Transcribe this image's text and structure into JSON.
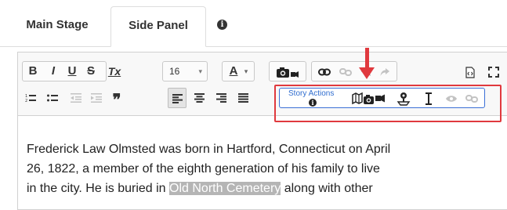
{
  "tabs": [
    {
      "label": "Main Stage",
      "active": false
    },
    {
      "label": "Side Panel",
      "active": true
    }
  ],
  "tab_info_glyph": "i",
  "toolbar": {
    "bold": "B",
    "italic": "I",
    "underline": "U",
    "strike": "S",
    "clear_format": "Tx",
    "font_size": "16",
    "font_color": "A",
    "story_actions_label": "Story Actions",
    "story_info_glyph": "i"
  },
  "colors": {
    "highlight": "#e0393e",
    "story_border": "#3b6fd6",
    "selection": "#b5b5b5"
  },
  "content": {
    "line1": "Frederick Law Olmsted was born in Hartford, Connecticut on April",
    "line2": "26, 1822, a member of the eighth generation of his family to live",
    "line3_before": "in the city. He is buried in ",
    "line3_selected": "Old North Cemetery",
    "line3_after": " along with other"
  }
}
